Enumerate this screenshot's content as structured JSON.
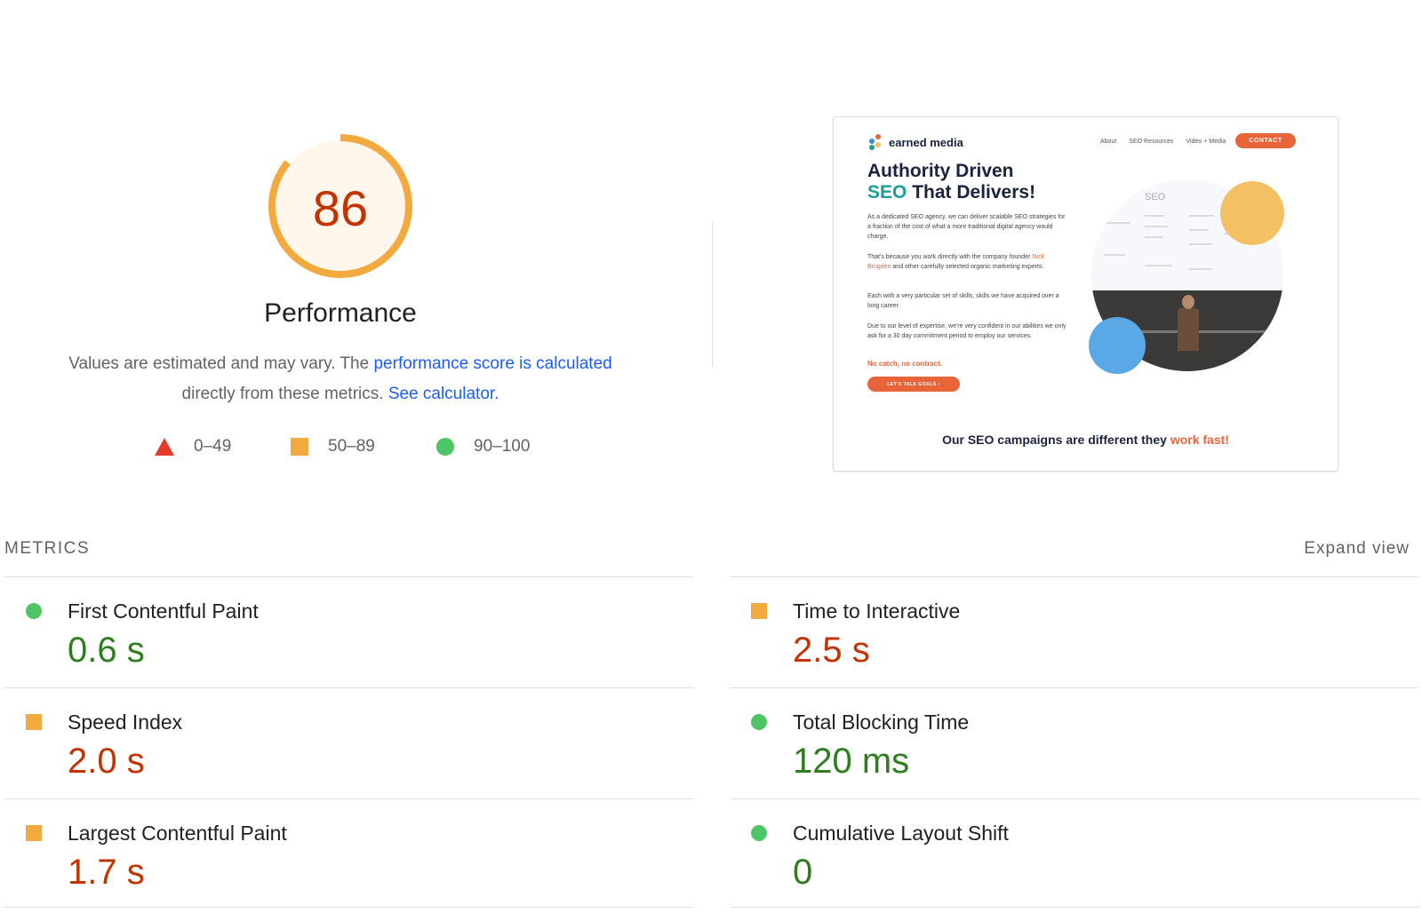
{
  "gauge": {
    "score": "86",
    "score_fraction": 0.86,
    "title": "Performance",
    "ring_color": "#f2a93d",
    "fill_color": "#fff6ec",
    "text_color": "#c33300"
  },
  "description": {
    "text_before": "Values are estimated and may vary. The ",
    "link1": "performance score is calculated",
    "text_middle": " directly from these metrics. ",
    "link2": "See calculator."
  },
  "legend": [
    {
      "range": "0–49",
      "shape": "triangle",
      "color": "#e5392c"
    },
    {
      "range": "50–89",
      "shape": "square",
      "color": "#f2a93d"
    },
    {
      "range": "90–100",
      "shape": "circle",
      "color": "#4ec565"
    }
  ],
  "screenshot": {
    "logo_text": "earned media",
    "nav": [
      "About",
      "SEO Resources",
      "Video + Media"
    ],
    "contact": "CONTACT",
    "headline_1": "Authority Driven",
    "headline_2_teal": "SEO",
    "headline_2_rest": " That Delivers!",
    "para1": "As a dedicated SEO agency, we can deliver scalable SEO strategies for a fraction of the cost of what a more traditional digital agency would charge.",
    "para2_before": "That's because you work directly with the company founder ",
    "para2_link": "Nick Brogden",
    "para2_after": " and other carefully selected organic marketing experts.",
    "para3": "Each with a very particular set of skills, skills we have acquired over a long career.",
    "para4": "Due to our level of expertise, we're very confident in our abilities we only ask for a 30 day commitment period to employ our services.",
    "no_catch": "No catch, no contract.",
    "cta": "LET'S TALK GOALS  ›",
    "photo_screen_title": "SEO",
    "bottom_before": "Our SEO campaigns are different they ",
    "bottom_highlight": "work fast!"
  },
  "metrics": {
    "header": "METRICS",
    "expand": "Expand view",
    "items": [
      {
        "name": "First Contentful Paint",
        "value": "0.6 s",
        "rating": "good",
        "icon": "green-circle-icon"
      },
      {
        "name": "Time to Interactive",
        "value": "2.5 s",
        "rating": "average",
        "icon": "orange-square-icon"
      },
      {
        "name": "Speed Index",
        "value": "2.0 s",
        "rating": "average",
        "icon": "orange-square-icon"
      },
      {
        "name": "Total Blocking Time",
        "value": "120 ms",
        "rating": "good",
        "icon": "green-circle-icon"
      },
      {
        "name": "Largest Contentful Paint",
        "value": "1.7 s",
        "rating": "average",
        "icon": "orange-square-icon"
      },
      {
        "name": "Cumulative Layout Shift",
        "value": "0",
        "rating": "good",
        "icon": "green-circle-icon"
      }
    ]
  }
}
